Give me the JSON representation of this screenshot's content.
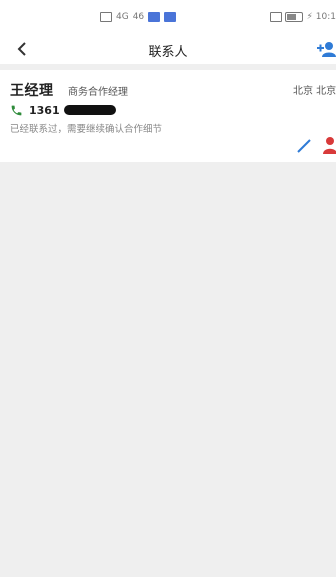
{
  "status_bar": {
    "time": "10:1",
    "signal_text": "4G",
    "wifi_text": "46"
  },
  "nav": {
    "title": "联系人",
    "icons": {
      "back": "chevron-left-icon",
      "add": "add-contact-icon"
    }
  },
  "contact": {
    "name": "王经理",
    "role": "商务合作经理",
    "location": "北京 北京",
    "phone_prefix": "1361",
    "note": "已经联系过，需要继续确认合作细节",
    "icons": {
      "phone": "phone-icon",
      "edit": "edit-icon",
      "person": "person-icon"
    }
  },
  "colors": {
    "accent_blue": "#2f7bd6",
    "phone_green": "#2e8b3a",
    "person_red": "#d83a3a",
    "background": "#efefef"
  }
}
